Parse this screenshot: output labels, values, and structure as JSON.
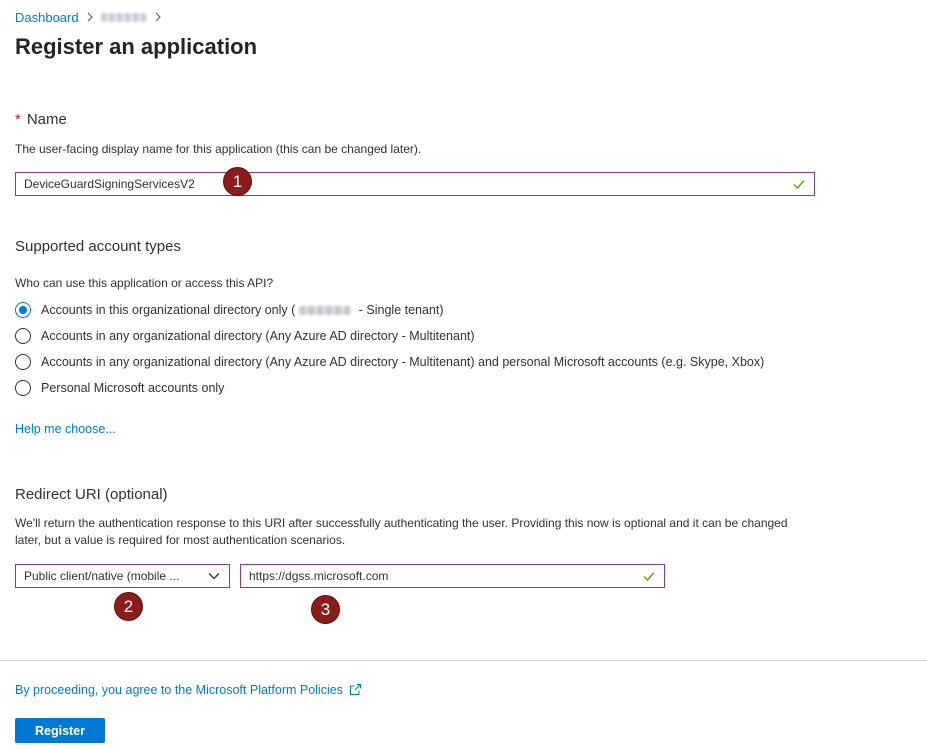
{
  "breadcrumb": {
    "items": [
      {
        "label": "Dashboard"
      }
    ]
  },
  "page": {
    "title": "Register an application"
  },
  "name_section": {
    "required_marker": "*",
    "label": "Name",
    "description": "The user-facing display name for this application (this can be changed later).",
    "value": "DeviceGuardSigningServicesV2"
  },
  "account_types": {
    "label": "Supported account types",
    "question": "Who can use this application or access this API?",
    "options": [
      {
        "label_before": "Accounts in this organizational directory only (",
        "label_after": " - Single tenant)",
        "selected": true
      },
      {
        "label": "Accounts in any organizational directory (Any Azure AD directory - Multitenant)",
        "selected": false
      },
      {
        "label": "Accounts in any organizational directory (Any Azure AD directory - Multitenant) and personal Microsoft accounts (e.g. Skype, Xbox)",
        "selected": false
      },
      {
        "label": "Personal Microsoft accounts only",
        "selected": false
      }
    ],
    "help_link": "Help me choose..."
  },
  "redirect": {
    "label": "Redirect URI (optional)",
    "description": "We'll return the authentication response to this URI after successfully authenticating the user. Providing this now is optional and it can be changed later, but a value is required for most authentication scenarios.",
    "platform_selected": "Public client/native (mobile ...",
    "uri_value": "https://dgss.microsoft.com"
  },
  "markers": [
    "1",
    "2",
    "3"
  ],
  "footer": {
    "policy_link": "By proceeding, you agree to the Microsoft Platform Policies",
    "register_label": "Register"
  },
  "colors": {
    "accent": "#0078d4",
    "input_border": "#8a3a95",
    "valid_check": "#57a300",
    "marker": "#8b1c1c"
  }
}
